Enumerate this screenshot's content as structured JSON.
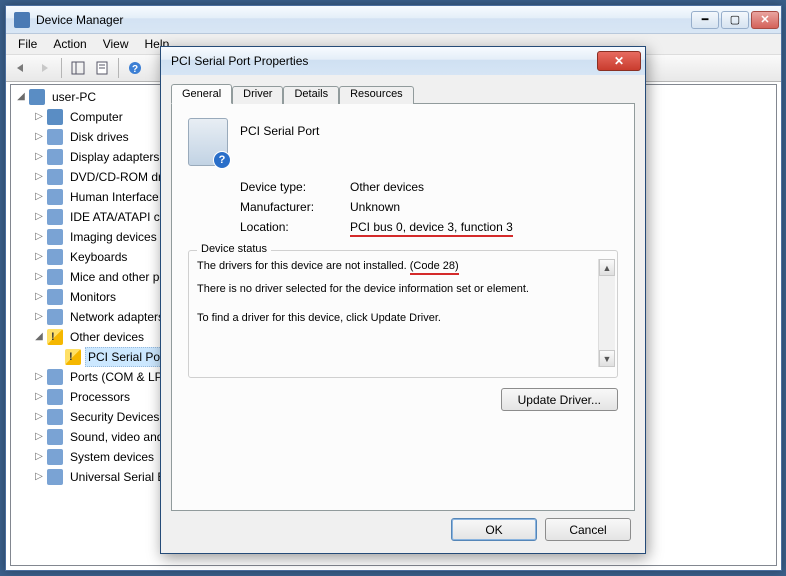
{
  "main_window": {
    "title": "Device Manager",
    "menu": [
      "File",
      "Action",
      "View",
      "Help"
    ]
  },
  "tree": {
    "root": "user-PC",
    "nodes": [
      {
        "label": "Computer",
        "icon": "pc"
      },
      {
        "label": "Disk drives"
      },
      {
        "label": "Display adapters"
      },
      {
        "label": "DVD/CD-ROM drives"
      },
      {
        "label": "Human Interface Devices"
      },
      {
        "label": "IDE ATA/ATAPI controllers"
      },
      {
        "label": "Imaging devices"
      },
      {
        "label": "Keyboards"
      },
      {
        "label": "Mice and other pointing devices"
      },
      {
        "label": "Monitors"
      },
      {
        "label": "Network adapters"
      },
      {
        "label": "Other devices",
        "expanded": true,
        "warn": true,
        "children": [
          {
            "label": "PCI Serial Port",
            "warn": true,
            "selected": true
          }
        ]
      },
      {
        "label": "Ports (COM & LPT)"
      },
      {
        "label": "Processors"
      },
      {
        "label": "Security Devices"
      },
      {
        "label": "Sound, video and game controllers"
      },
      {
        "label": "System devices"
      },
      {
        "label": "Universal Serial Bus controllers"
      }
    ]
  },
  "dialog": {
    "title": "PCI Serial Port Properties",
    "tabs": [
      "General",
      "Driver",
      "Details",
      "Resources"
    ],
    "active_tab": 0,
    "device_name": "PCI Serial Port",
    "rows": {
      "type_label": "Device type:",
      "type_value": "Other devices",
      "mfr_label": "Manufacturer:",
      "mfr_value": "Unknown",
      "loc_label": "Location:",
      "loc_value": "PCI bus 0, device 3, function 3"
    },
    "status_legend": "Device status",
    "status_line1a": "The drivers for this device are not installed. ",
    "status_line1b": "(Code 28)",
    "status_line2": "There is no driver selected for the device information set or element.",
    "status_line3": "To find a driver for this device, click Update Driver.",
    "update_btn": "Update Driver...",
    "ok": "OK",
    "cancel": "Cancel"
  }
}
